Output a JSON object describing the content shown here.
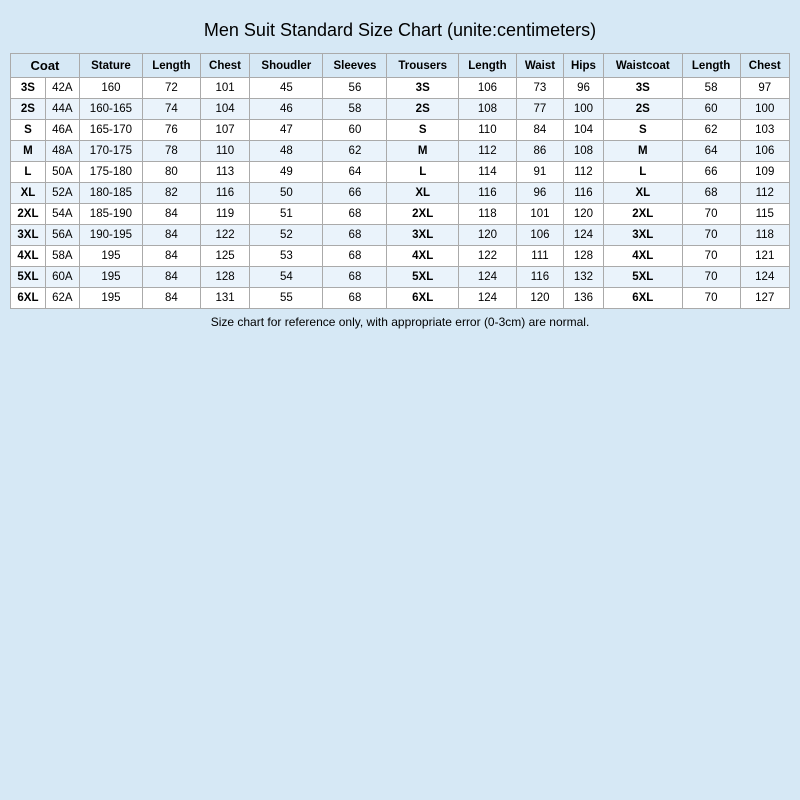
{
  "title": "Men Suit Standard Size Chart   (unite:centimeters)",
  "headers": {
    "coat": "Coat",
    "stature": "Stature",
    "length": "Length",
    "chest": "Chest",
    "shoulder": "Shoudler",
    "sleeves": "Sleeves",
    "trousers": "Trousers",
    "t_length": "Length",
    "waist": "Waist",
    "hips": "Hips",
    "waistcoat": "Waistcoat",
    "w_length": "Length",
    "w_chest": "Chest"
  },
  "rows": [
    {
      "coat": "3S",
      "code": "42A",
      "stature": "160",
      "length": "72",
      "chest": "101",
      "shoulder": "45",
      "sleeves": "56",
      "trousers": "3S",
      "t_length": "106",
      "waist": "73",
      "hips": "96",
      "waistcoat": "3S",
      "w_length": "58",
      "w_chest": "97"
    },
    {
      "coat": "2S",
      "code": "44A",
      "stature": "160-165",
      "length": "74",
      "chest": "104",
      "shoulder": "46",
      "sleeves": "58",
      "trousers": "2S",
      "t_length": "108",
      "waist": "77",
      "hips": "100",
      "waistcoat": "2S",
      "w_length": "60",
      "w_chest": "100"
    },
    {
      "coat": "S",
      "code": "46A",
      "stature": "165-170",
      "length": "76",
      "chest": "107",
      "shoulder": "47",
      "sleeves": "60",
      "trousers": "S",
      "t_length": "110",
      "waist": "84",
      "hips": "104",
      "waistcoat": "S",
      "w_length": "62",
      "w_chest": "103"
    },
    {
      "coat": "M",
      "code": "48A",
      "stature": "170-175",
      "length": "78",
      "chest": "110",
      "shoulder": "48",
      "sleeves": "62",
      "trousers": "M",
      "t_length": "112",
      "waist": "86",
      "hips": "108",
      "waistcoat": "M",
      "w_length": "64",
      "w_chest": "106"
    },
    {
      "coat": "L",
      "code": "50A",
      "stature": "175-180",
      "length": "80",
      "chest": "113",
      "shoulder": "49",
      "sleeves": "64",
      "trousers": "L",
      "t_length": "114",
      "waist": "91",
      "hips": "112",
      "waistcoat": "L",
      "w_length": "66",
      "w_chest": "109"
    },
    {
      "coat": "XL",
      "code": "52A",
      "stature": "180-185",
      "length": "82",
      "chest": "116",
      "shoulder": "50",
      "sleeves": "66",
      "trousers": "XL",
      "t_length": "116",
      "waist": "96",
      "hips": "116",
      "waistcoat": "XL",
      "w_length": "68",
      "w_chest": "112"
    },
    {
      "coat": "2XL",
      "code": "54A",
      "stature": "185-190",
      "length": "84",
      "chest": "119",
      "shoulder": "51",
      "sleeves": "68",
      "trousers": "2XL",
      "t_length": "118",
      "waist": "101",
      "hips": "120",
      "waistcoat": "2XL",
      "w_length": "70",
      "w_chest": "115"
    },
    {
      "coat": "3XL",
      "code": "56A",
      "stature": "190-195",
      "length": "84",
      "chest": "122",
      "shoulder": "52",
      "sleeves": "68",
      "trousers": "3XL",
      "t_length": "120",
      "waist": "106",
      "hips": "124",
      "waistcoat": "3XL",
      "w_length": "70",
      "w_chest": "118"
    },
    {
      "coat": "4XL",
      "code": "58A",
      "stature": "195",
      "length": "84",
      "chest": "125",
      "shoulder": "53",
      "sleeves": "68",
      "trousers": "4XL",
      "t_length": "122",
      "waist": "111",
      "hips": "128",
      "waistcoat": "4XL",
      "w_length": "70",
      "w_chest": "121"
    },
    {
      "coat": "5XL",
      "code": "60A",
      "stature": "195",
      "length": "84",
      "chest": "128",
      "shoulder": "54",
      "sleeves": "68",
      "trousers": "5XL",
      "t_length": "124",
      "waist": "116",
      "hips": "132",
      "waistcoat": "5XL",
      "w_length": "70",
      "w_chest": "124"
    },
    {
      "coat": "6XL",
      "code": "62A",
      "stature": "195",
      "length": "84",
      "chest": "131",
      "shoulder": "55",
      "sleeves": "68",
      "trousers": "6XL",
      "t_length": "124",
      "waist": "120",
      "hips": "136",
      "waistcoat": "6XL",
      "w_length": "70",
      "w_chest": "127"
    }
  ],
  "footer": "Size chart for reference only, with appropriate error (0-3cm) are normal."
}
